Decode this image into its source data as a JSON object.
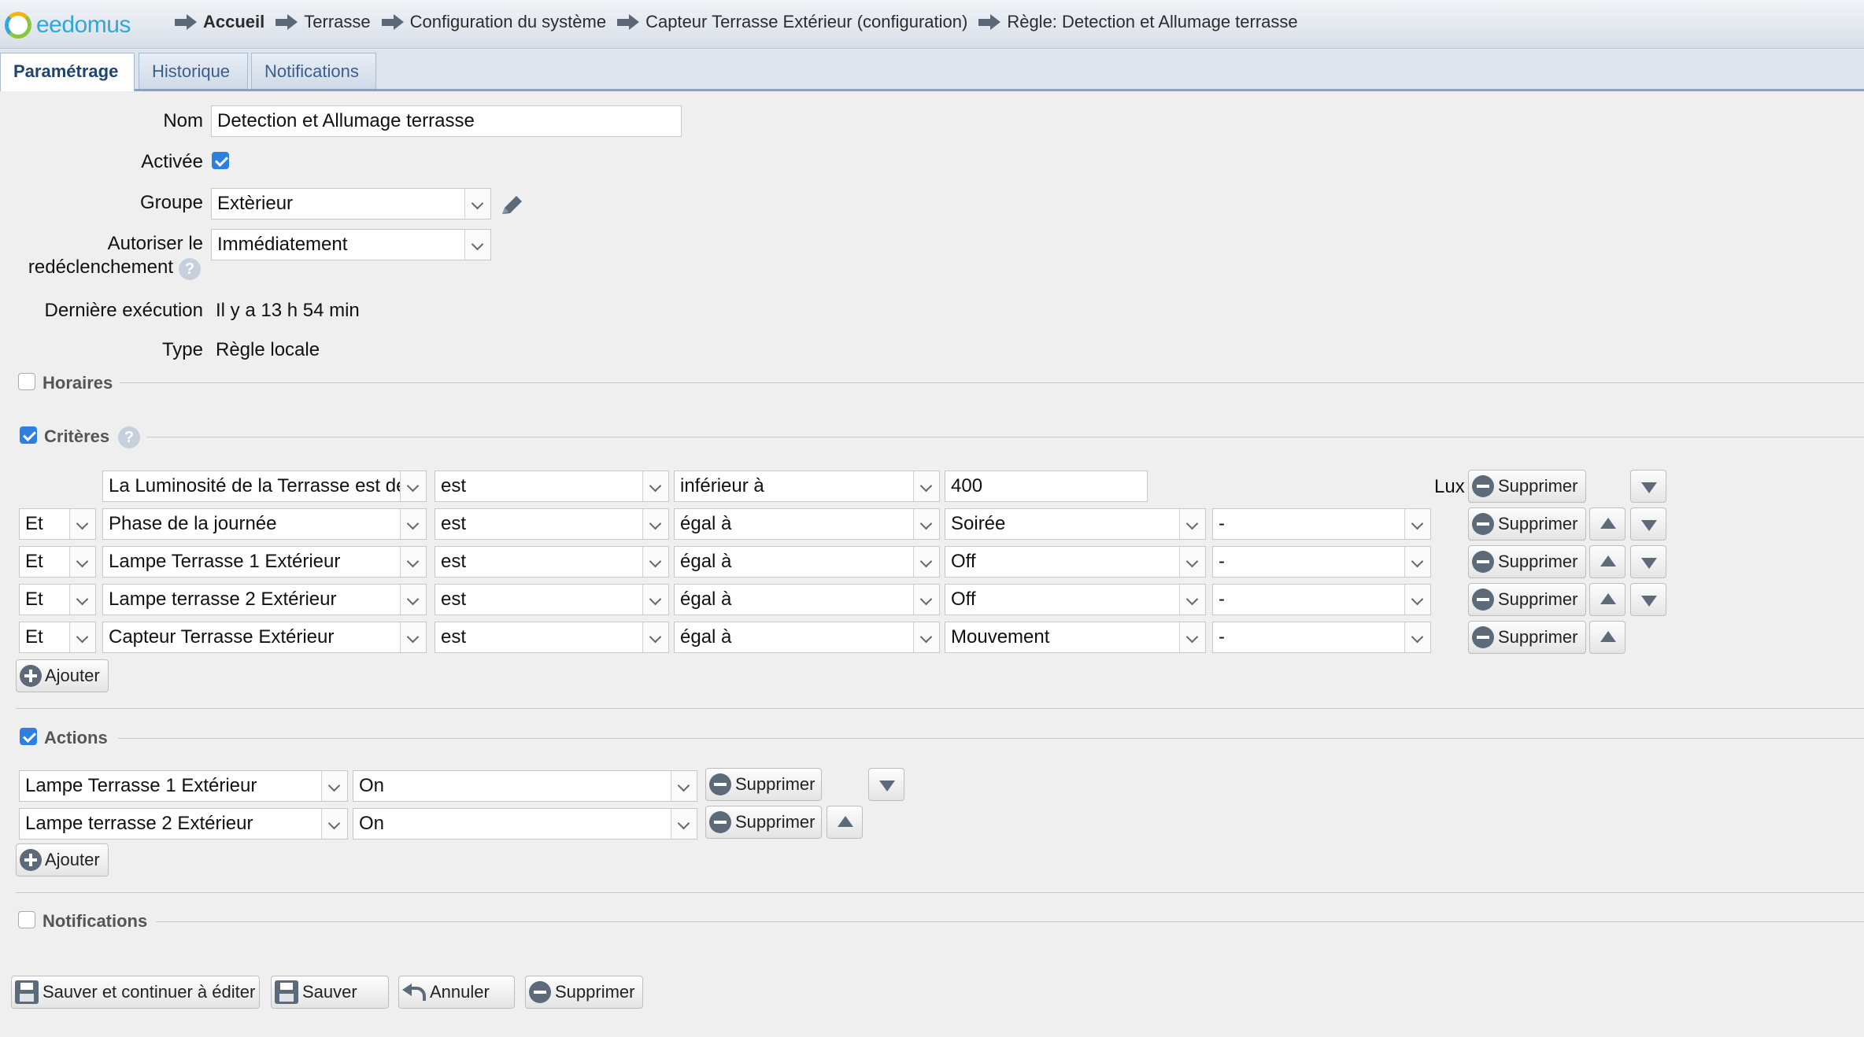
{
  "app": {
    "logo": "eedomus"
  },
  "breadcrumb": [
    {
      "label": "Accueil"
    },
    {
      "label": "Terrasse"
    },
    {
      "label": "Configuration du système"
    },
    {
      "label": "Capteur Terrasse Extérieur (configuration)"
    },
    {
      "label": "Règle: Detection et Allumage terrasse"
    }
  ],
  "tabs": [
    {
      "label": "Paramétrage",
      "active": true
    },
    {
      "label": "Historique",
      "active": false
    },
    {
      "label": "Notifications",
      "active": false
    }
  ],
  "form": {
    "nom_label": "Nom",
    "nom_value": "Detection et Allumage terrasse",
    "activee_label": "Activée",
    "activee_checked": true,
    "groupe_label": "Groupe",
    "groupe_value": "Extèrieur",
    "autoriser_label_1": "Autoriser le",
    "autoriser_label_2": "redéclenchement",
    "autoriser_value": "Immédiatement",
    "derniere_label": "Dernière exécution",
    "derniere_value": "Il y a 13 h 54 min",
    "type_label": "Type",
    "type_value": "Règle locale"
  },
  "sections": {
    "horaires": {
      "title": "Horaires",
      "checked": false
    },
    "criteres": {
      "title": "Critères",
      "checked": true
    },
    "actions": {
      "title": "Actions",
      "checked": true
    },
    "notifications": {
      "title": "Notifications",
      "checked": false
    }
  },
  "criteria": [
    {
      "conj": "",
      "device": "La Luminosité de la Terrasse est de",
      "verb": "est",
      "op": "inférieur à",
      "value": "400",
      "extra": "",
      "unit": "Lux",
      "delete_label": "Supprimer"
    },
    {
      "conj": "Et",
      "device": "Phase de la journée",
      "verb": "est",
      "op": "égal à",
      "value": "Soirée",
      "extra": "-",
      "unit": "",
      "delete_label": "Supprimer"
    },
    {
      "conj": "Et",
      "device": "Lampe Terrasse 1 Extérieur",
      "verb": "est",
      "op": "égal à",
      "value": "Off",
      "extra": "-",
      "unit": "",
      "delete_label": "Supprimer"
    },
    {
      "conj": "Et",
      "device": "Lampe terrasse 2 Extérieur",
      "verb": "est",
      "op": "égal à",
      "value": "Off",
      "extra": "-",
      "unit": "",
      "delete_label": "Supprimer"
    },
    {
      "conj": "Et",
      "device": "Capteur Terrasse Extérieur",
      "verb": "est",
      "op": "égal à",
      "value": "Mouvement",
      "extra": "-",
      "unit": "",
      "delete_label": "Supprimer"
    }
  ],
  "criteria_add_label": "Ajouter",
  "actions": [
    {
      "device": "Lampe Terrasse 1 Extérieur",
      "value": "On",
      "delete_label": "Supprimer"
    },
    {
      "device": "Lampe terrasse 2 Extérieur",
      "value": "On",
      "delete_label": "Supprimer"
    }
  ],
  "actions_add_label": "Ajouter",
  "footer_buttons": {
    "save_continue": "Sauver et continuer à éditer",
    "save": "Sauver",
    "cancel": "Annuler",
    "delete": "Supprimer"
  },
  "colors": {
    "accent": "#2d7fe0",
    "tab_border": "#7fa3d2"
  }
}
